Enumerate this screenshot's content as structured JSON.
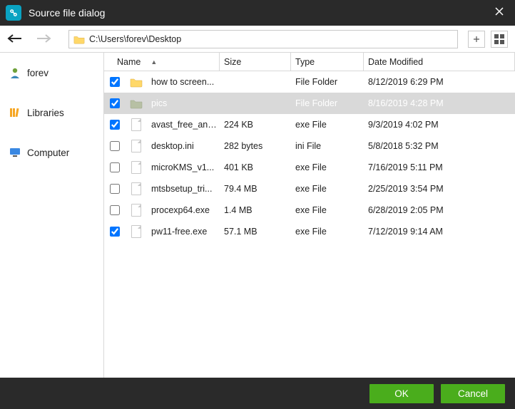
{
  "titlebar": {
    "title": "Source file dialog"
  },
  "toolbar": {
    "path": "C:\\Users\\forev\\Desktop"
  },
  "sidebar": {
    "items": [
      {
        "label": "forev"
      },
      {
        "label": "Libraries"
      },
      {
        "label": "Computer"
      }
    ]
  },
  "columns": {
    "name": "Name",
    "size": "Size",
    "type": "Type",
    "date": "Date Modified"
  },
  "files": [
    {
      "checked": true,
      "kind": "folder",
      "name": "how to screen...",
      "size": "",
      "type": "File Folder",
      "date": "8/12/2019 6:29 PM",
      "selected": false
    },
    {
      "checked": true,
      "kind": "folder",
      "name": "pics",
      "size": "",
      "type": "File Folder",
      "date": "8/16/2019 4:28 PM",
      "selected": true
    },
    {
      "checked": true,
      "kind": "file",
      "name": "avast_free_ant...",
      "size": "224 KB",
      "type": "exe File",
      "date": "9/3/2019 4:02 PM",
      "selected": false
    },
    {
      "checked": false,
      "kind": "file",
      "name": "desktop.ini",
      "size": "282 bytes",
      "type": "ini File",
      "date": "5/8/2018 5:32 PM",
      "selected": false
    },
    {
      "checked": false,
      "kind": "file",
      "name": "microKMS_v1...",
      "size": "401 KB",
      "type": "exe File",
      "date": "7/16/2019 5:11 PM",
      "selected": false
    },
    {
      "checked": false,
      "kind": "file",
      "name": "mtsbsetup_tri...",
      "size": "79.4 MB",
      "type": "exe File",
      "date": "2/25/2019 3:54 PM",
      "selected": false
    },
    {
      "checked": false,
      "kind": "file",
      "name": "procexp64.exe",
      "size": "1.4 MB",
      "type": "exe File",
      "date": "6/28/2019 2:05 PM",
      "selected": false
    },
    {
      "checked": true,
      "kind": "file",
      "name": "pw11-free.exe",
      "size": "57.1 MB",
      "type": "exe File",
      "date": "7/12/2019 9:14 AM",
      "selected": false
    }
  ],
  "footer": {
    "ok": "OK",
    "cancel": "Cancel"
  },
  "colors": {
    "accent": "#4aad1c",
    "titlebar": "#2a2a2a"
  }
}
